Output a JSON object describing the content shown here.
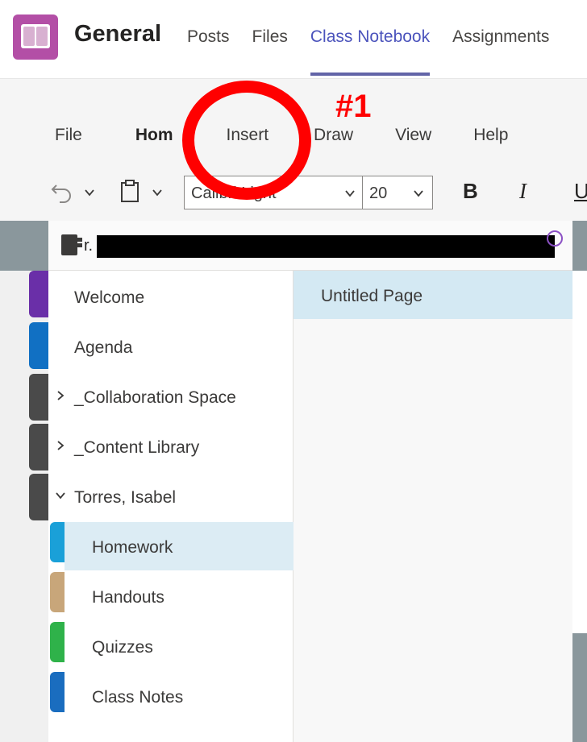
{
  "header": {
    "app_icon": "notebook-app-icon",
    "team_title": "General",
    "tabs": [
      {
        "label": "Posts"
      },
      {
        "label": "Files"
      },
      {
        "label": "Class Notebook",
        "active": true
      },
      {
        "label": "Assignments"
      }
    ]
  },
  "ribbon": {
    "tabs": [
      {
        "label": "File"
      },
      {
        "label": "Hom",
        "active": true
      },
      {
        "label": "Insert"
      },
      {
        "label": "Draw"
      },
      {
        "label": "View"
      },
      {
        "label": "Help"
      }
    ],
    "toolbar": {
      "undo_icon": "undo-icon",
      "paste_icon": "clipboard-icon",
      "font_name": "Calibri Light",
      "font_size": "20",
      "bold_label": "B",
      "italic_label": "I",
      "underline_label": "U"
    }
  },
  "notebook": {
    "icon": "notebook-icon",
    "title_prefix": "r."
  },
  "sections": {
    "items": [
      {
        "label": "Welcome"
      },
      {
        "label": "Agenda"
      },
      {
        "label": "_Collaboration Space",
        "expandable": true
      },
      {
        "label": "_Content Library",
        "expandable": true
      },
      {
        "label": "Torres, Isabel",
        "expanded": true
      },
      {
        "label": "Homework",
        "selected": true,
        "color": "#1aa0d8"
      },
      {
        "label": "Handouts",
        "color": "#c8a67a"
      },
      {
        "label": "Quizzes",
        "color": "#2fb24a"
      },
      {
        "label": "Class Notes",
        "color": "#1a6dbf"
      }
    ],
    "rail_colors": [
      "#6a2fa8",
      "#1170c3",
      "#4a4a4a",
      "#4a4a4a",
      "#4a4a4a"
    ]
  },
  "pages": {
    "items": [
      {
        "label": "Untitled Page",
        "selected": true
      }
    ]
  },
  "annotation": {
    "label": "#1",
    "color": "#ff0000"
  },
  "colors": {
    "accent": "#6264a7",
    "active_tab_text": "#4b53bc",
    "selected_row": "#dcecf4"
  }
}
